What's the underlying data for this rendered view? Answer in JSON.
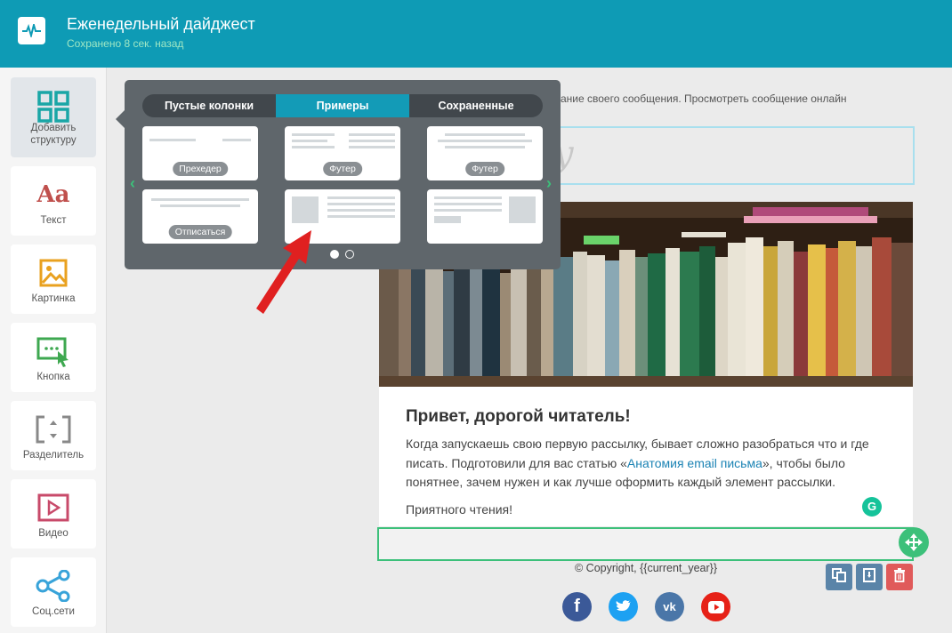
{
  "header": {
    "title": "Еженедельный дайджест",
    "save_status": "Сохранено 8 сек. назад"
  },
  "sidebar": {
    "items": [
      {
        "label": "Добавить структуру",
        "icon": "grid-icon"
      },
      {
        "label": "Текст",
        "icon": "text-icon"
      },
      {
        "label": "Картинка",
        "icon": "image-icon"
      },
      {
        "label": "Кнопка",
        "icon": "button-icon"
      },
      {
        "label": "Разделитель",
        "icon": "divider-icon"
      },
      {
        "label": "Видео",
        "icon": "video-icon"
      },
      {
        "label": "Соц.сети",
        "icon": "share-icon"
      }
    ]
  },
  "popup": {
    "tabs": [
      "Пустые колонки",
      "Примеры",
      "Сохраненные"
    ],
    "active_tab": "Примеры",
    "templates": [
      "Прехедер",
      "Футер",
      "Футер",
      "Отписаться",
      "",
      ""
    ],
    "page": 1,
    "pages": 2
  },
  "canvas": {
    "preheader_text": "ание своего сообщения. Просмотреть сообщение онлайн",
    "heading": "Привет, дорогой читатель!",
    "body_before": "Когда запускаешь свою первую рассылку, бывает сложно разобраться что и где писать. Подготовили для вас статью «",
    "body_link": "Анатомия email письма",
    "body_after": "», чтобы было понятнее, зачем нужен и как лучше оформить каждый элемент рассылки.",
    "sign": "Приятного чтения!",
    "copyright": "© Copyright, {{current_year}}"
  },
  "social": [
    "facebook-icon",
    "twitter-icon",
    "vk-icon",
    "youtube-icon"
  ],
  "colors": {
    "header": "#0e9bb5",
    "accent_green": "#3cc07a",
    "active_tab": "#139bb7"
  }
}
